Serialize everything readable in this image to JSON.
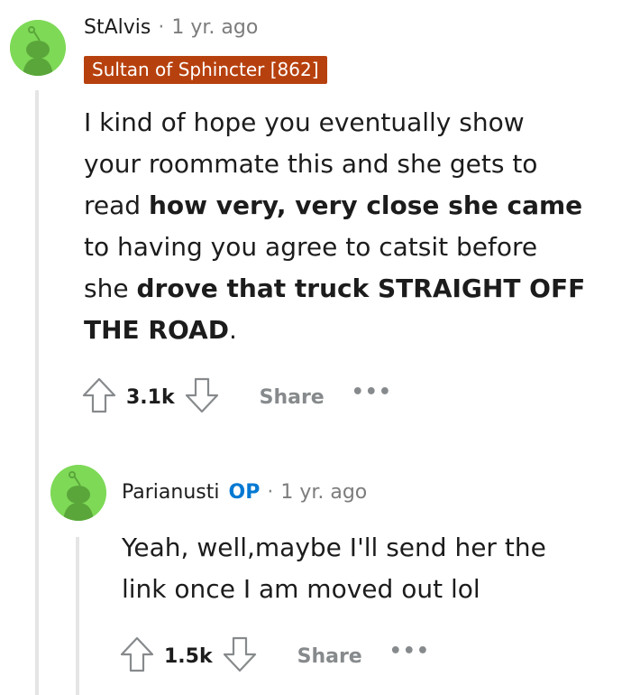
{
  "comments": [
    {
      "username": "StAlvis",
      "separator": "·",
      "time": "1 yr. ago",
      "flair": "Sultan of Sphincter [862]",
      "body": {
        "part1": "I kind of hope you eventually show your roommate this and she gets to read ",
        "bold1": "how very, very close she came",
        "part2": " to having you agree to catsit before she ",
        "bold2": "drove that truck STRAIGHT OFF THE ROAD",
        "part3": "."
      },
      "score": "3.1k",
      "share_label": "Share",
      "more_label": "•••"
    },
    {
      "username": "Parianusti",
      "op_badge": "OP",
      "separator": "·",
      "time": "1 yr. ago",
      "body": {
        "text": "Yeah, well,maybe I'll send her the link once I am moved out lol"
      },
      "score": "1.5k",
      "share_label": "Share",
      "more_label": "•••"
    }
  ],
  "colors": {
    "avatar_bg": "#7ed957",
    "flair_bg": "#b7410e",
    "op_blue": "#0079d3",
    "muted": "#878a8c"
  },
  "icons": {
    "upvote": "arrow-up-icon",
    "downvote": "arrow-down-icon",
    "avatar": "snoo-avatar-icon"
  }
}
